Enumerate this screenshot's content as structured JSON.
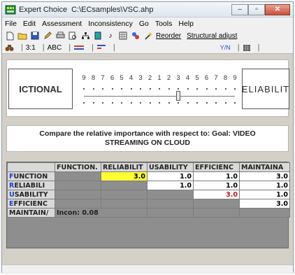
{
  "window": {
    "app_name": "Expert Choice",
    "file_path": "C:\\ECsamples\\VSC.ahp",
    "minimize": "–",
    "maximize": "▫",
    "close": "✕"
  },
  "menu": [
    "File",
    "Edit",
    "Assessment",
    "Inconsistency",
    "Go",
    "Tools",
    "Help"
  ],
  "toolbar": {
    "reorder_label": "Reorder",
    "structural_adjust_label": "Structural adjust"
  },
  "toolbar2": {
    "ratio_label": "3:1",
    "abc_label": "ABC",
    "verbal_label": "Y/N"
  },
  "comparison": {
    "left_label": "ICTIONAL",
    "right_label": "ELIABILIT",
    "scale_numbers": [
      "9",
      "8",
      "7",
      "6",
      "5",
      "4",
      "3",
      "2",
      "1",
      "2",
      "3",
      "4",
      "5",
      "6",
      "7",
      "8",
      "9"
    ],
    "slider_value": 3,
    "slider_side": "right"
  },
  "prompt": {
    "line1": "Compare the relative importance  with respect to: Goal: VIDEO",
    "line2": "STREAMING ON CLOUD"
  },
  "matrix": {
    "columns": [
      "FUNCTION.",
      "RELIABILIT",
      "USABILITY",
      "EFFICIENC",
      "MAINTAINA"
    ],
    "rows": [
      {
        "label": "FUNCTION",
        "first": "F",
        "rest": "UNCTION",
        "cells": [
          "",
          "3.0",
          "1.0",
          "1.0",
          "3.0"
        ]
      },
      {
        "label": "RELIABILI",
        "first": "R",
        "rest": "ELIABILI",
        "cells": [
          "",
          "",
          "1.0",
          "1.0",
          "1.0"
        ]
      },
      {
        "label": "USABILITY",
        "first": "U",
        "rest": "SABILITY",
        "cells": [
          "",
          "",
          "",
          "3.0",
          "1.0"
        ]
      },
      {
        "label": "EFFICIENC",
        "first": "E",
        "rest": "FFICIENC",
        "cells": [
          "",
          "",
          "",
          "",
          "3.0"
        ]
      }
    ],
    "last_row_label": "MAINTAIN/",
    "inconsistency": "Incon: 0.08"
  }
}
